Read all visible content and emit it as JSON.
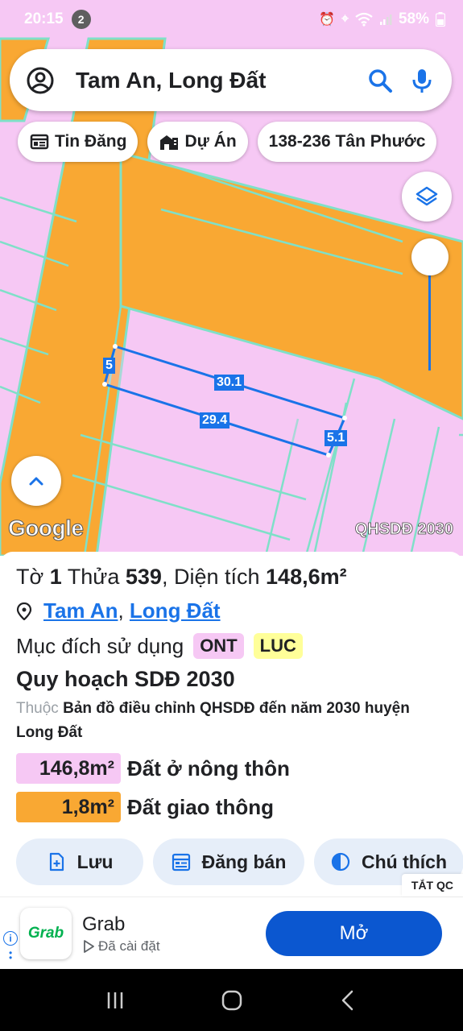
{
  "status_bar": {
    "time": "20:15",
    "notification_count": "2",
    "battery": "58%"
  },
  "search": {
    "query": "Tam An, Long Đất"
  },
  "chips": [
    {
      "label": "Tin Đăng",
      "icon": "listing-icon"
    },
    {
      "label": "Dự Án",
      "icon": "buildings-icon"
    },
    {
      "label": "138-236 Tân Phước",
      "icon": ""
    }
  ],
  "map": {
    "measurements": {
      "top": "30.1",
      "bottom": "29.4",
      "left": "5",
      "right": "5.1"
    },
    "logo_text": "Google",
    "layer_label": "QHSDĐ 2030"
  },
  "parcel": {
    "prefix_to": "Tờ",
    "to_number": "1",
    "thua_label": "Thửa",
    "thua_number": "539",
    "area_label": ", Diện tích",
    "area_value": "148,6m²",
    "location_1": "Tam An",
    "location_sep": ",",
    "location_2": "Long Đất",
    "purpose_label": "Mục đích sử dụng",
    "purpose_codes": [
      "ONT",
      "LUC"
    ],
    "plan_title": "Quy hoạch SDĐ 2030",
    "plan_prefix": "Thuộc",
    "plan_desc": "Bản đồ điều chỉnh QHSDĐ đến năm 2030 huyện Long Đất",
    "areas": [
      {
        "value": "146,8m²",
        "label": "Đất ở nông thôn",
        "color": "#f6c8f4"
      },
      {
        "value": "1,8m²",
        "label": "Đất giao thông",
        "color": "#f9a833"
      }
    ]
  },
  "actions": [
    {
      "label": "Lưu",
      "icon": "add-file-icon"
    },
    {
      "label": "Đăng bán",
      "icon": "calendar-icon"
    },
    {
      "label": "Chú thích",
      "icon": "contrast-icon"
    }
  ],
  "ad": {
    "close_label": "TẮT QC",
    "logo_text": "Grab",
    "app_name": "Grab",
    "installed_text": "Đã cài đặt",
    "open_label": "Mở"
  },
  "colors": {
    "residential": "#f6c8f4",
    "road": "#f9a833",
    "accent": "#1a73e8",
    "button": "#0b57d0"
  }
}
